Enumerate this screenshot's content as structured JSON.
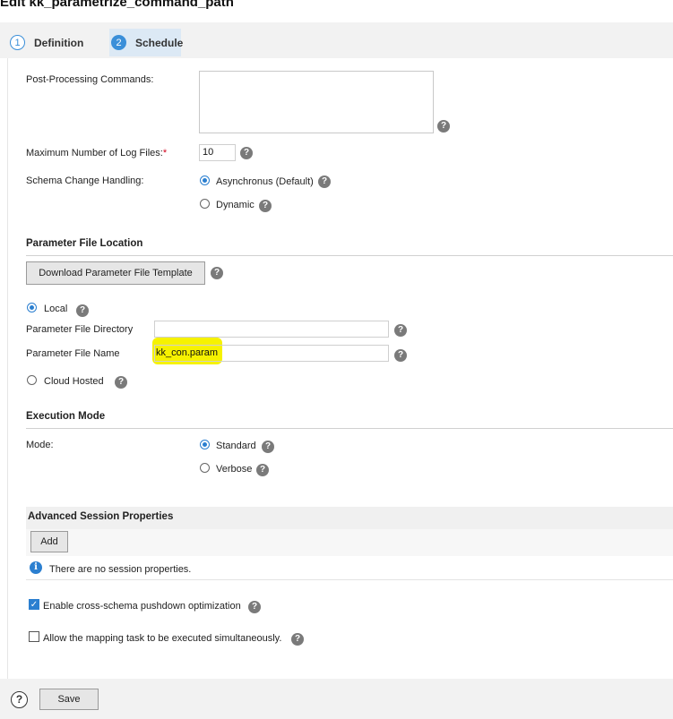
{
  "page": {
    "title": "Edit kk_parametrize_command_path"
  },
  "steps": [
    {
      "num": "1",
      "label": "Definition"
    },
    {
      "num": "2",
      "label": "Schedule"
    }
  ],
  "form": {
    "post_processing_label": "Post-Processing Commands:",
    "max_log_label": "Maximum Number of Log Files:",
    "max_log_required": "*",
    "max_log_value": "10",
    "schema_label": "Schema Change Handling:",
    "schema_options": [
      "Asynchronus (Default)",
      "Dynamic"
    ]
  },
  "param_section": {
    "title": "Parameter File Location",
    "download_button": "Download Parameter File Template",
    "local_label": "Local",
    "dir_label": "Parameter File Directory",
    "dir_value": "",
    "name_label": "Parameter File Name",
    "name_value": "kk_con.param",
    "cloud_label": "Cloud Hosted"
  },
  "exec_section": {
    "title": "Execution Mode",
    "mode_label": "Mode:",
    "options": [
      "Standard",
      "Verbose"
    ]
  },
  "advanced": {
    "title": "Advanced Session Properties",
    "add_button": "Add",
    "empty_message": "There are no session properties."
  },
  "options": {
    "pushdown_label": "Enable cross-schema pushdown optimization",
    "simultaneous_label": "Allow the mapping task to be executed simultaneously."
  },
  "footer": {
    "help_glyph": "?",
    "save_label": "Save"
  },
  "icons": {
    "help": "?",
    "info": "i",
    "check": "✓"
  },
  "colors": {
    "accent": "#2b7fd0",
    "highlight": "#f6f200",
    "required": "#d0021b"
  }
}
